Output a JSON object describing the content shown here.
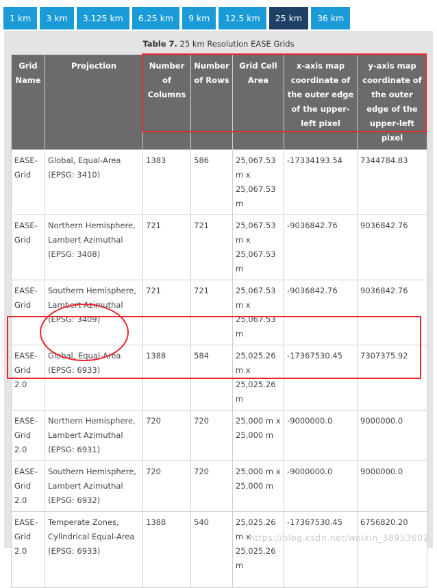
{
  "tabs": [
    {
      "label": "1 km",
      "active": false
    },
    {
      "label": "3 km",
      "active": false
    },
    {
      "label": "3.125 km",
      "active": false
    },
    {
      "label": "6.25 km",
      "active": false
    },
    {
      "label": "9 km",
      "active": false
    },
    {
      "label": "12.5 km",
      "active": false
    },
    {
      "label": "25 km",
      "active": true
    },
    {
      "label": "36 km",
      "active": false
    }
  ],
  "caption": {
    "label": "Table 7.",
    "text": " 25 km Resolution EASE Grids"
  },
  "headers": [
    "Grid Name",
    "Projection",
    "Number of Columns",
    "Number of Rows",
    "Grid Cell Area",
    "x-axis map coordinate of the outer edge of the upper-left pixel",
    "y-axis map coordinate of the outer edge of the upper-left pixel"
  ],
  "rows": [
    [
      "EASE-Grid",
      "Global, Equal-Area (EPSG: 3410)",
      "1383",
      "586",
      "25,067.53 m x 25,067.53 m",
      "-17334193.54",
      "7344784.83"
    ],
    [
      "EASE-Grid",
      "Northern Hemisphere, Lambert Azimuthal (EPSG: 3408)",
      "721",
      "721",
      "25,067.53 m x 25,067.53 m",
      "-9036842.76",
      "9036842.76"
    ],
    [
      "EASE-Grid",
      "Southern Hemisphere, Lambert Azimuthal (EPSG: 3409)",
      "721",
      "721",
      "25,067.53 m x 25,067.53 m",
      "-9036842.76",
      "9036842.76"
    ],
    [
      "EASE-Grid 2.0",
      "Global, Equal-Area (EPSG: 6933)",
      "1388",
      "584",
      "25,025.26 m x 25,025.26 m",
      "-17367530.45",
      "7307375.92"
    ],
    [
      "EASE-Grid 2.0",
      "Northern Hemisphere, Lambert Azimuthal (EPSG: 6931)",
      "720",
      "720",
      "25,000 m x 25,000 m",
      "-9000000.0",
      "9000000.0"
    ],
    [
      "EASE-Grid 2.0",
      "Southern Hemisphere, Lambert Azimuthal (EPSG: 6932)",
      "720",
      "720",
      "25,000 m x 25,000 m",
      "-9000000.0",
      "9000000.0"
    ],
    [
      "EASE-Grid 2.0",
      "Temperate Zones, Cylindrical Equal-Area (EPSG: 6933)",
      "1388",
      "540",
      "25,025.26 m x 25,025.26 m",
      "-17367530.45",
      "6756820.20"
    ]
  ],
  "watermark": "https://blog.csdn.net/weixin_38953602",
  "colors": {
    "tab": "#1a9bd7",
    "tab_active": "#1e3f66",
    "header": "#6b6b6b",
    "highlight": "#e8262b"
  }
}
